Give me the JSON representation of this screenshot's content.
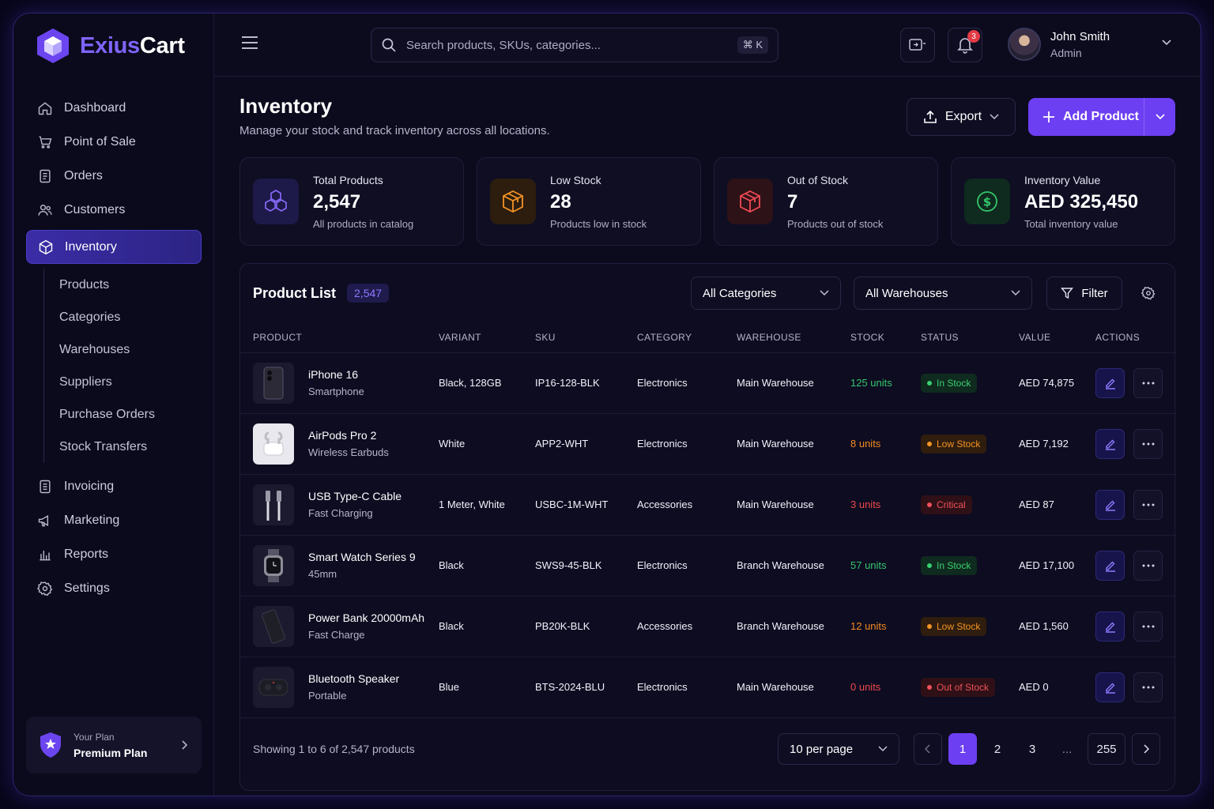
{
  "brand": {
    "part1": "Exius",
    "part2": "Cart"
  },
  "nav": {
    "items": [
      {
        "label": "Dashboard"
      },
      {
        "label": "Point of Sale"
      },
      {
        "label": "Orders"
      },
      {
        "label": "Customers"
      },
      {
        "label": "Inventory"
      },
      {
        "label": "Invoicing"
      },
      {
        "label": "Marketing"
      },
      {
        "label": "Reports"
      },
      {
        "label": "Settings"
      }
    ],
    "sub_items": [
      {
        "label": "Products"
      },
      {
        "label": "Categories"
      },
      {
        "label": "Warehouses"
      },
      {
        "label": "Suppliers"
      },
      {
        "label": "Purchase Orders"
      },
      {
        "label": "Stock Transfers"
      }
    ]
  },
  "plan": {
    "label": "Your Plan",
    "name": "Premium Plan"
  },
  "search": {
    "placeholder": "Search products, SKUs, categories...",
    "shortcut": "⌘ K"
  },
  "notifications": {
    "count": "3"
  },
  "user": {
    "name": "John Smith",
    "role": "Admin"
  },
  "page": {
    "title": "Inventory",
    "subtitle": "Manage your stock and track inventory across all locations.",
    "export_label": "Export",
    "add_label": "Add Product"
  },
  "stats": [
    {
      "label": "Total Products",
      "value": "2,547",
      "note": "All products in catalog",
      "color": "#7b5cff"
    },
    {
      "label": "Low Stock",
      "value": "28",
      "note": "Products low in stock",
      "color": "#f59324"
    },
    {
      "label": "Out of Stock",
      "value": "7",
      "note": "Products out of stock",
      "color": "#ef4a55"
    },
    {
      "label": "Inventory Value",
      "value": "AED 325,450",
      "note": "Total inventory value",
      "color": "#34c76c"
    }
  ],
  "product_list": {
    "title": "Product List",
    "count": "2,547",
    "category_filter": "All Categories",
    "warehouse_filter": "All Warehouses",
    "filter_label": "Filter",
    "columns": [
      "PRODUCT",
      "VARIANT",
      "SKU",
      "CATEGORY",
      "WAREHOUSE",
      "STOCK",
      "STATUS",
      "VALUE",
      "ACTIONS"
    ],
    "rows": [
      {
        "name": "iPhone 16",
        "sub": "Smartphone",
        "variant": "Black, 128GB",
        "sku": "IP16-128-BLK",
        "category": "Electronics",
        "warehouse": "Main Warehouse",
        "stock": "125 units",
        "status": "In Stock",
        "value": "AED 74,875"
      },
      {
        "name": "AirPods Pro 2",
        "sub": "Wireless Earbuds",
        "variant": "White",
        "sku": "APP2-WHT",
        "category": "Electronics",
        "warehouse": "Main Warehouse",
        "stock": "8 units",
        "status": "Low Stock",
        "value": "AED 7,192"
      },
      {
        "name": "USB Type-C Cable",
        "sub": "Fast Charging",
        "variant": "1 Meter, White",
        "sku": "USBC-1M-WHT",
        "category": "Accessories",
        "warehouse": "Main Warehouse",
        "stock": "3 units",
        "status": "Critical",
        "value": "AED 87"
      },
      {
        "name": "Smart Watch Series 9",
        "sub": "45mm",
        "variant": "Black",
        "sku": "SWS9-45-BLK",
        "category": "Electronics",
        "warehouse": "Branch Warehouse",
        "stock": "57 units",
        "status": "In Stock",
        "value": "AED 17,100"
      },
      {
        "name": "Power Bank 20000mAh",
        "sub": "Fast Charge",
        "variant": "Black",
        "sku": "PB20K-BLK",
        "category": "Accessories",
        "warehouse": "Branch Warehouse",
        "stock": "12 units",
        "status": "Low Stock",
        "value": "AED 1,560"
      },
      {
        "name": "Bluetooth Speaker",
        "sub": "Portable",
        "variant": "Blue",
        "sku": "BTS-2024-BLU",
        "category": "Electronics",
        "warehouse": "Main Warehouse",
        "stock": "0 units",
        "status": "Out of Stock",
        "value": "AED 0"
      }
    ],
    "showing": "Showing 1 to 6 of 2,547 products",
    "per_page": "10 per page",
    "pages": [
      "1",
      "2",
      "3",
      "...",
      "255"
    ]
  }
}
